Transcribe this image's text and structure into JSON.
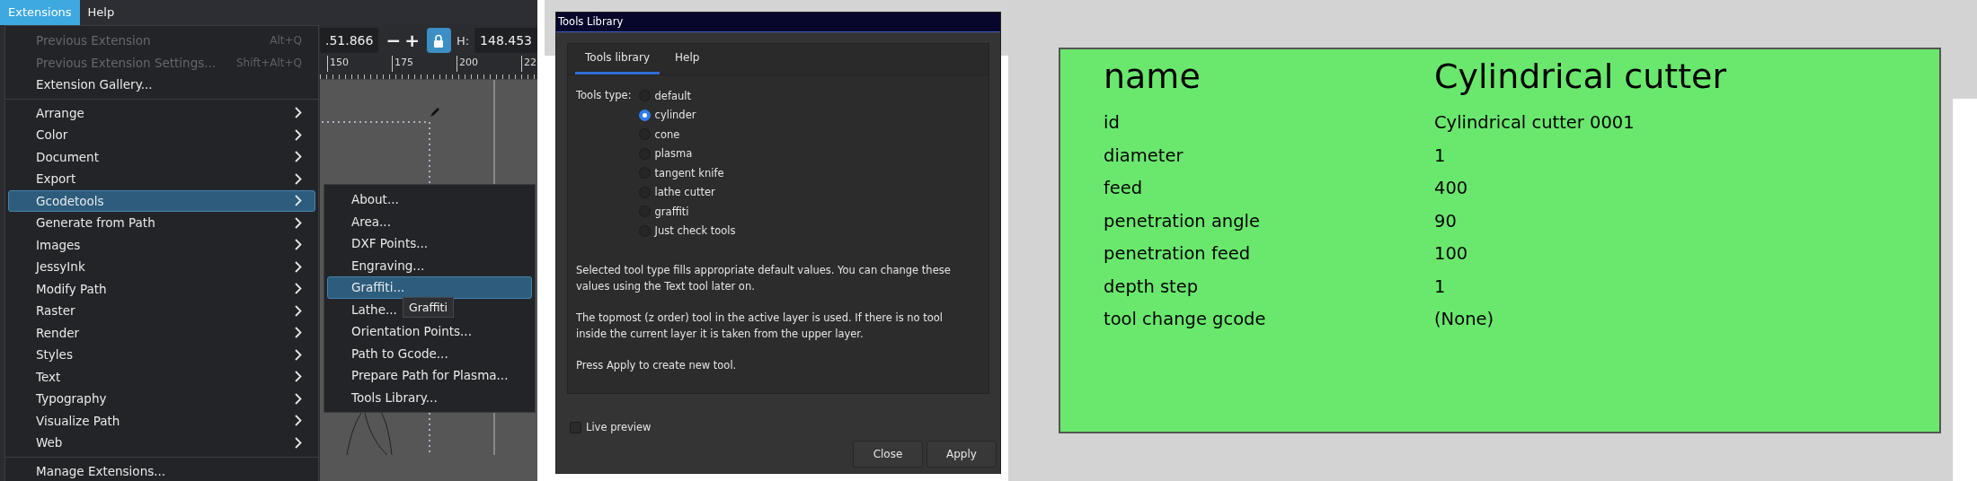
{
  "menubar": [
    {
      "label": "Extensions",
      "selected": true
    },
    {
      "label": "Help",
      "selected": false
    }
  ],
  "toolbar": {
    "x_value": ".51.866",
    "minus": "−",
    "plus": "+",
    "locked": true,
    "h_label": "H:",
    "h_value": "148.453"
  },
  "ruler_labels": [
    "150",
    "175",
    "200",
    "22"
  ],
  "extensions_menu": [
    {
      "kind": "item",
      "label": "Previous Extension",
      "shortcut": "Alt+Q",
      "disabled": true,
      "selected": false
    },
    {
      "kind": "item",
      "label": "Previous Extension Settings...",
      "shortcut": "Shift+Alt+Q",
      "disabled": true,
      "selected": false
    },
    {
      "kind": "item",
      "label": "Extension Gallery...",
      "disabled": false,
      "selected": false
    },
    {
      "kind": "separator"
    },
    {
      "kind": "submenu",
      "label": "Arrange",
      "disabled": false,
      "selected": false
    },
    {
      "kind": "submenu",
      "label": "Color",
      "disabled": false,
      "selected": false
    },
    {
      "kind": "submenu",
      "label": "Document",
      "disabled": false,
      "selected": false
    },
    {
      "kind": "submenu",
      "label": "Export",
      "disabled": false,
      "selected": false
    },
    {
      "kind": "submenu",
      "label": "Gcodetools",
      "disabled": false,
      "selected": true
    },
    {
      "kind": "submenu",
      "label": "Generate from Path",
      "disabled": false,
      "selected": false
    },
    {
      "kind": "submenu",
      "label": "Images",
      "disabled": false,
      "selected": false
    },
    {
      "kind": "submenu",
      "label": "JessyInk",
      "disabled": false,
      "selected": false
    },
    {
      "kind": "submenu",
      "label": "Modify Path",
      "disabled": false,
      "selected": false
    },
    {
      "kind": "submenu",
      "label": "Raster",
      "disabled": false,
      "selected": false
    },
    {
      "kind": "submenu",
      "label": "Render",
      "disabled": false,
      "selected": false
    },
    {
      "kind": "submenu",
      "label": "Styles",
      "disabled": false,
      "selected": false
    },
    {
      "kind": "submenu",
      "label": "Text",
      "disabled": false,
      "selected": false
    },
    {
      "kind": "submenu",
      "label": "Typography",
      "disabled": false,
      "selected": false
    },
    {
      "kind": "submenu",
      "label": "Visualize Path",
      "disabled": false,
      "selected": false
    },
    {
      "kind": "submenu",
      "label": "Web",
      "disabled": false,
      "selected": false
    },
    {
      "kind": "separator"
    },
    {
      "kind": "item",
      "label": "Manage Extensions...",
      "disabled": false,
      "selected": false
    }
  ],
  "gcodetools_submenu": [
    {
      "label": "About...",
      "selected": false
    },
    {
      "label": "Area...",
      "selected": false
    },
    {
      "label": "DXF Points...",
      "selected": false
    },
    {
      "label": "Engraving...",
      "selected": false
    },
    {
      "label": "Graffiti...",
      "selected": true
    },
    {
      "label": "Lathe...",
      "selected": false
    },
    {
      "label": "Orientation Points...",
      "selected": false
    },
    {
      "label": "Path to Gcode...",
      "selected": false
    },
    {
      "label": "Prepare Path for Plasma...",
      "selected": false
    },
    {
      "label": "Tools Library...",
      "selected": false
    }
  ],
  "tooltip": "Graffiti",
  "dialog": {
    "title": "Tools Library",
    "tabs": [
      {
        "label": "Tools library",
        "selected": true
      },
      {
        "label": "Help",
        "selected": false
      }
    ],
    "tools_type_label": "Tools type:",
    "tool_types": [
      {
        "label": "default",
        "selected": false
      },
      {
        "label": "cylinder",
        "selected": true
      },
      {
        "label": "cone",
        "selected": false
      },
      {
        "label": "plasma",
        "selected": false
      },
      {
        "label": "tangent knife",
        "selected": false
      },
      {
        "label": "lathe cutter",
        "selected": false
      },
      {
        "label": "graffiti",
        "selected": false
      },
      {
        "label": "Just check tools",
        "selected": false
      }
    ],
    "paragraphs": [
      "Selected tool type fills appropriate default values. You can change these values using the Text tool later on.",
      "The topmost (z order) tool in the active layer is used. If there is no tool inside the current layer it is taken from the upper layer.",
      "Press Apply to create new tool."
    ],
    "live_preview": {
      "label": "Live preview",
      "checked": false
    },
    "buttons": [
      "Close",
      "Apply"
    ]
  },
  "tool_card": {
    "name_label": "name",
    "name_value": "Cylindrical cutter",
    "rows": [
      {
        "label": "id",
        "value": "Cylindrical cutter 0001"
      },
      {
        "label": "diameter",
        "value": "1"
      },
      {
        "label": "feed",
        "value": "400"
      },
      {
        "label": "penetration angle",
        "value": "90"
      },
      {
        "label": "penetration feed",
        "value": "100"
      },
      {
        "label": "depth step",
        "value": "1"
      },
      {
        "label": "tool change gcode",
        "value": "(None)"
      }
    ]
  }
}
